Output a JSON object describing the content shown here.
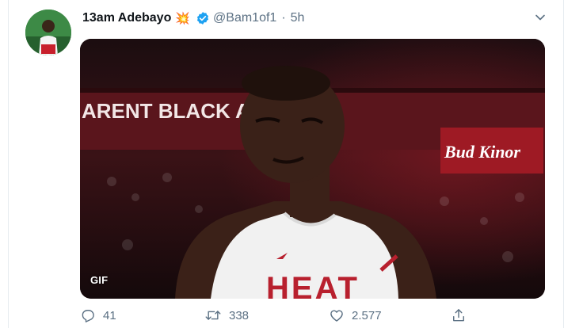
{
  "tweet": {
    "author_name": "13am Adebayo",
    "author_emoji": "💥",
    "handle": "@Bam1of1",
    "separator": "·",
    "time": "5h",
    "media": {
      "badge": "GIF",
      "banner_text": "ARENT BLACK A     E",
      "sponsor_text": "Bud Kinor",
      "jersey_text": "HEAT"
    },
    "actions": {
      "reply_count": "41",
      "retweet_count": "338",
      "like_count": "2.577"
    }
  },
  "colors": {
    "verified": "#1da1f2",
    "muted": "#5b7083",
    "heat_red": "#b8202e"
  },
  "icons": [
    "verified-badge-icon",
    "chevron-down-icon",
    "reply-icon",
    "retweet-icon",
    "like-icon",
    "share-icon"
  ]
}
